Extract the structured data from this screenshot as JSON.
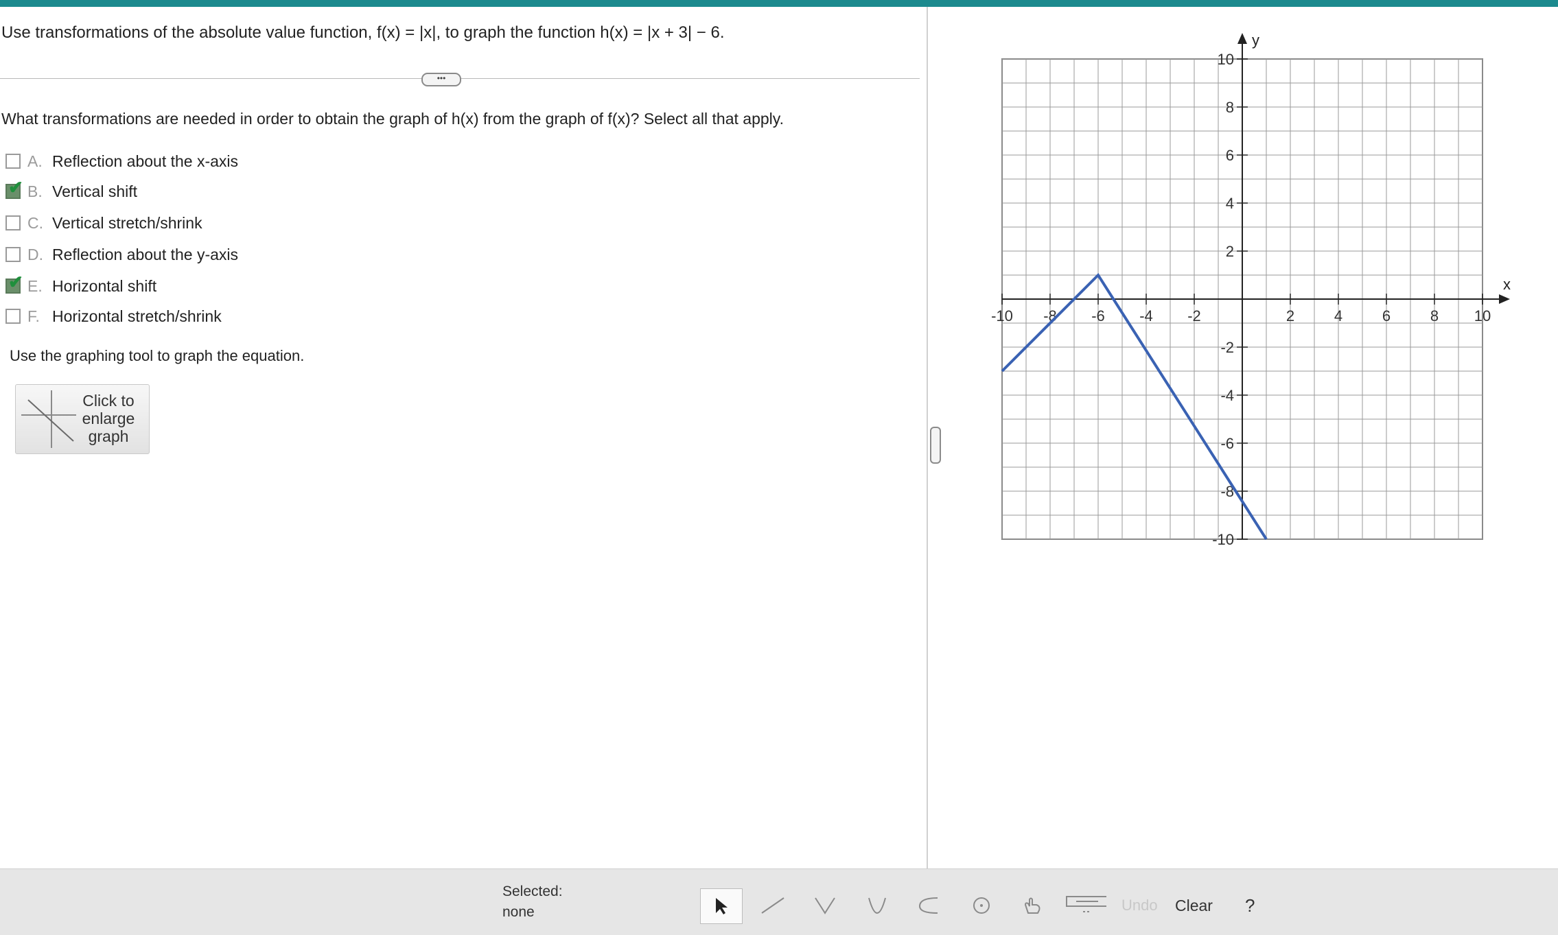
{
  "question": {
    "text": "Use transformations of the absolute value function, f(x) = |x|, to graph the function h(x) = |x + 3| − 6."
  },
  "prompt": "What transformations are needed in order to obtain the graph of h(x) from the graph of f(x)? Select all that apply.",
  "options": [
    {
      "letter": "A.",
      "label": "Reflection about the x-axis",
      "checked": false
    },
    {
      "letter": "B.",
      "label": "Vertical shift",
      "checked": true
    },
    {
      "letter": "C.",
      "label": "Vertical stretch/shrink",
      "checked": false
    },
    {
      "letter": "D.",
      "label": "Reflection about the y-axis",
      "checked": false
    },
    {
      "letter": "E.",
      "label": "Horizontal shift",
      "checked": true
    },
    {
      "letter": "F.",
      "label": "Horizontal stretch/shrink",
      "checked": false
    }
  ],
  "instruction": "Use the graphing tool to graph the equation.",
  "enlarge_button": {
    "line1": "Click to",
    "line2": "enlarge",
    "line3": "graph"
  },
  "graph": {
    "x_label": "x",
    "y_label": "y",
    "x_range": [
      -10,
      10
    ],
    "y_range": [
      -10,
      10
    ],
    "tick_step": 2,
    "grid": true,
    "x_tick_labels": [
      "-10",
      "-8",
      "-6",
      "-4",
      "-2",
      "2",
      "4",
      "6",
      "8",
      "10"
    ],
    "y_tick_labels": [
      "10",
      "8",
      "6",
      "4",
      "2",
      "-2",
      "-4",
      "-6",
      "-8",
      "-10"
    ],
    "line_color": "#3a62b3",
    "plotted_points": [
      [
        -10,
        -3
      ],
      [
        -6,
        1
      ],
      [
        1,
        -10
      ]
    ]
  },
  "toolbar": {
    "selected_label": "Selected:",
    "selected_value": "none",
    "clear": "Clear",
    "undo": "Undo",
    "help": "?"
  },
  "colors": {
    "accent": "#1c8a8e",
    "check": "#1f8f3c"
  }
}
